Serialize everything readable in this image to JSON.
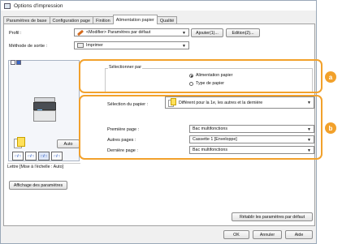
{
  "window": {
    "title": "Options d'impression"
  },
  "tabs": [
    {
      "label": "Paramètres de base",
      "active": false
    },
    {
      "label": "Configuration page",
      "active": false
    },
    {
      "label": "Finition",
      "active": false
    },
    {
      "label": "Alimentation papier",
      "active": true
    },
    {
      "label": "Qualité",
      "active": false
    }
  ],
  "profile": {
    "label": "Profil :",
    "value": "<Modifier> Paramètres par défaut",
    "add_button": "Ajouter(1)...",
    "edit_button": "Edition(2)..."
  },
  "output_method": {
    "label": "Méthode de sortie :",
    "value": "Imprimer"
  },
  "preview": {
    "auto_button": "Auto",
    "layout_icons": [
      "□/□",
      "□/□",
      "□/□",
      "□/□"
    ],
    "status_text": "Lettre [Mise à l'échelle : Auto]"
  },
  "select_by": {
    "group_label": "Sélectionner par",
    "options": [
      {
        "label": "Alimentation papier",
        "selected": true
      },
      {
        "label": "Type de papier",
        "selected": false
      }
    ]
  },
  "paper_selection": {
    "label": "Sélection du papier :",
    "value": "Différent pour la 1e, les autres et la dernière"
  },
  "pages": {
    "first": {
      "label": "Première page :",
      "value": "Bac multifonctions"
    },
    "others": {
      "label": "Autres pages :",
      "value": "Cassette 1 [Enveloppe]"
    },
    "last": {
      "label": "Dernière page :",
      "value": "Bac multifonctions"
    }
  },
  "buttons": {
    "show_settings": "Affichage des paramètres",
    "restore_defaults": "Rétablir les paramètres par défaut",
    "ok": "OK",
    "cancel": "Annuler",
    "help": "Aide"
  },
  "callouts": {
    "a": "a",
    "b": "b"
  },
  "colors": {
    "callout": "#f2a12b",
    "paper_yellow": "#ffe05b",
    "accent": "#3a66c4"
  }
}
